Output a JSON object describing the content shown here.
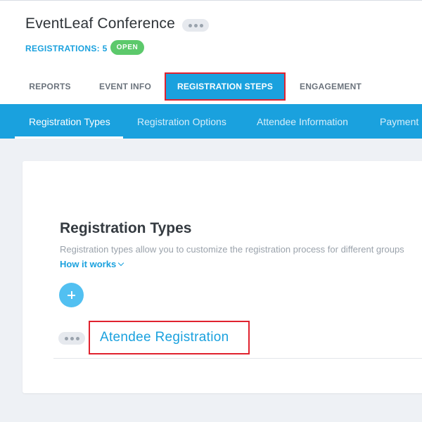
{
  "header": {
    "event_title": "EventLeaf Conference",
    "registrations_label": "REGISTRATIONS: 5",
    "status_badge": "OPEN"
  },
  "main_tabs": [
    {
      "label": "REPORTS",
      "active": false
    },
    {
      "label": "EVENT INFO",
      "active": false
    },
    {
      "label": "REGISTRATION STEPS",
      "active": true
    },
    {
      "label": "ENGAGEMENT",
      "active": false
    }
  ],
  "sub_tabs": [
    {
      "label": "Registration Types",
      "active": true
    },
    {
      "label": "Registration Options",
      "active": false
    },
    {
      "label": "Attendee Information",
      "active": false
    },
    {
      "label": "Payment",
      "active": false
    }
  ],
  "section": {
    "title": "Registration Types",
    "description": "Registration types allow you to customize the registration process for different groups",
    "how_link": "How it works"
  },
  "registration_types": [
    {
      "name": "Atendee Registration"
    }
  ],
  "icons": {
    "more": "more-dots-icon",
    "add": "plus-icon",
    "chevron": "chevron-down-icon"
  },
  "colors": {
    "accent": "#1aa1de",
    "badge_green": "#5cc96b",
    "highlight_red": "#e0222e"
  }
}
